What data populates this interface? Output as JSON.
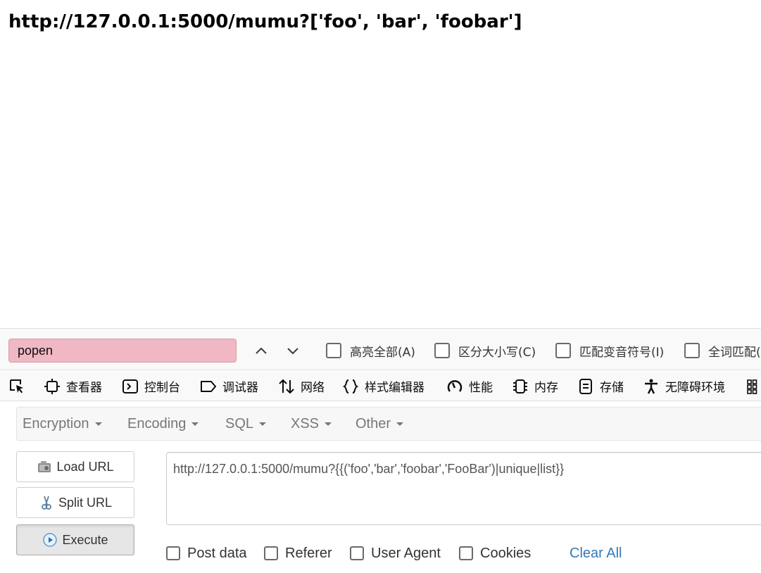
{
  "page": {
    "heading": "http://127.0.0.1:5000/mumu?['foo', 'bar', 'foobar']"
  },
  "findbar": {
    "query": "popen",
    "options": [
      {
        "label": "高亮全部(A)"
      },
      {
        "label": "区分大小写(C)"
      },
      {
        "label": "匹配变音符号(I)"
      },
      {
        "label": "全词匹配("
      }
    ]
  },
  "devtools": {
    "tabs": [
      {
        "label": "查看器",
        "icon": "inspector-icon"
      },
      {
        "label": "控制台",
        "icon": "console-icon"
      },
      {
        "label": "调试器",
        "icon": "debugger-icon"
      },
      {
        "label": "网络",
        "icon": "network-icon"
      },
      {
        "label": "样式编辑器",
        "icon": "style-editor-icon"
      },
      {
        "label": "性能",
        "icon": "performance-icon"
      },
      {
        "label": "内存",
        "icon": "memory-icon"
      },
      {
        "label": "存储",
        "icon": "storage-icon"
      },
      {
        "label": "无障碍环境",
        "icon": "accessibility-icon"
      }
    ]
  },
  "hackbar": {
    "menu": [
      "Encryption",
      "Encoding",
      "SQL",
      "XSS",
      "Other"
    ],
    "buttons": {
      "load_url": "Load URL",
      "split_url": "Split URL",
      "execute": "Execute"
    },
    "url": "http://127.0.0.1:5000/mumu?{{('foo','bar','foobar','FooBar')|unique|list}}",
    "checks": [
      "Post data",
      "Referer",
      "User Agent",
      "Cookies"
    ],
    "clear_all": "Clear All"
  },
  "colors": {
    "find_input_bg": "#f0b8c4",
    "link_blue": "#337ab7"
  }
}
